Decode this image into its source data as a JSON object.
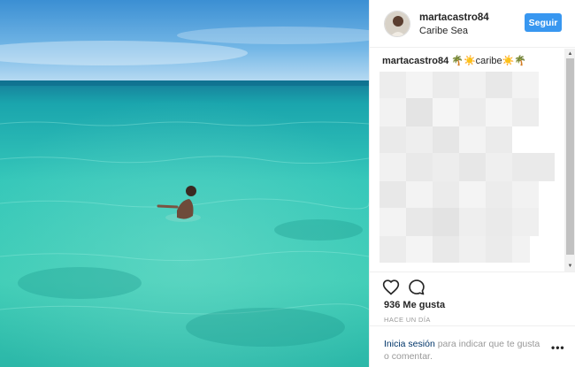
{
  "post": {
    "username": "martacastro84",
    "location": "Caribe Sea",
    "follow_label": "Seguir",
    "caption_user": "martacastro84",
    "caption_text": "🌴☀️caribe☀️🌴",
    "likes": "936 Me gusta",
    "time": "HACE UN DÍA"
  },
  "login": {
    "link_text": "Inicia sesión",
    "rest_text": " para indicar que te gusta o comentar."
  },
  "colors": {
    "accent": "#3897f0",
    "sky": "#4d9fd9",
    "sea": "#2cc3b5"
  }
}
